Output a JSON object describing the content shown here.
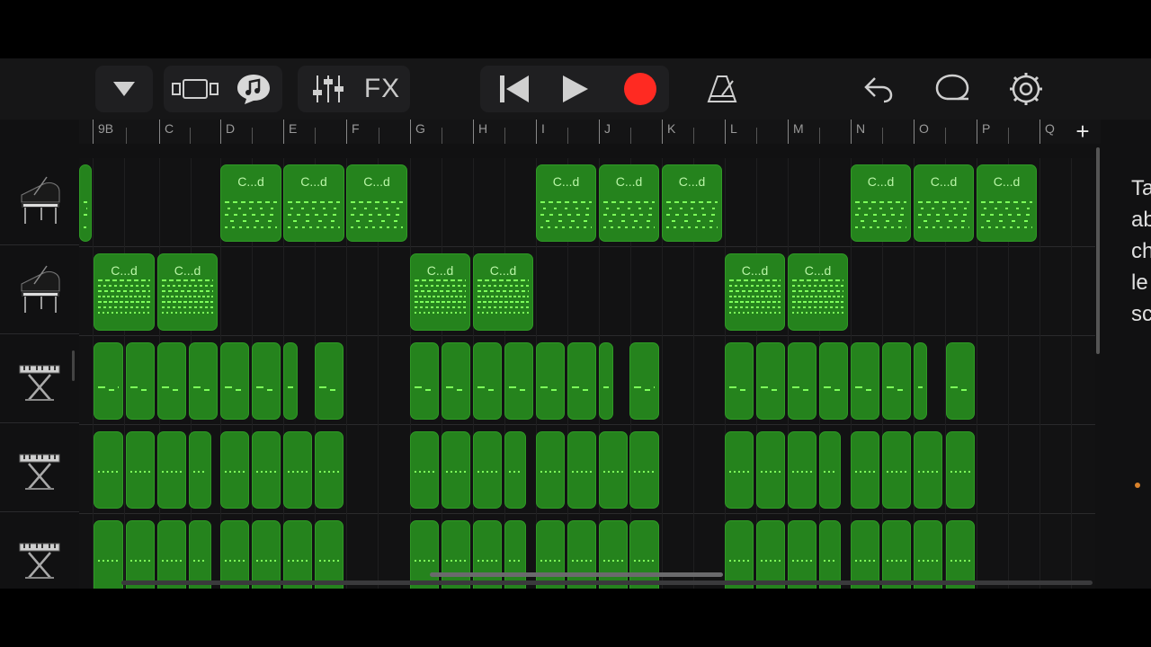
{
  "toolbar": {
    "fx_label": "FX",
    "record_color": "#ff2a22",
    "icons": [
      "triangle-down-icon",
      "view-toggle-icon",
      "smart-control-icon",
      "mixer-icon",
      "rewind-icon",
      "play-icon",
      "record-icon",
      "metronome-icon",
      "undo-icon",
      "loop-icon",
      "settings-icon"
    ]
  },
  "ruler": {
    "labels": [
      "9B",
      "C",
      "D",
      "E",
      "F",
      "G",
      "H",
      "I",
      "J",
      "K",
      "L",
      "M",
      "N",
      "O",
      "P",
      "Q"
    ],
    "add_label": "+"
  },
  "tracks": [
    {
      "name": "grand-piano",
      "icon": "grand-piano-icon"
    },
    {
      "name": "grand-piano",
      "icon": "grand-piano-icon"
    },
    {
      "name": "keyboard",
      "icon": "keyboard-stand-icon"
    },
    {
      "name": "keyboard",
      "icon": "keyboard-stand-icon"
    },
    {
      "name": "keyboard",
      "icon": "keyboard-stand-icon"
    }
  ],
  "region_label": "C...d",
  "side_panel": {
    "text": "Ta\nab\nch\nle\nsc"
  },
  "colors": {
    "region_fill": "#25831d",
    "note_color": "#7dff5a",
    "background": "#111112"
  }
}
